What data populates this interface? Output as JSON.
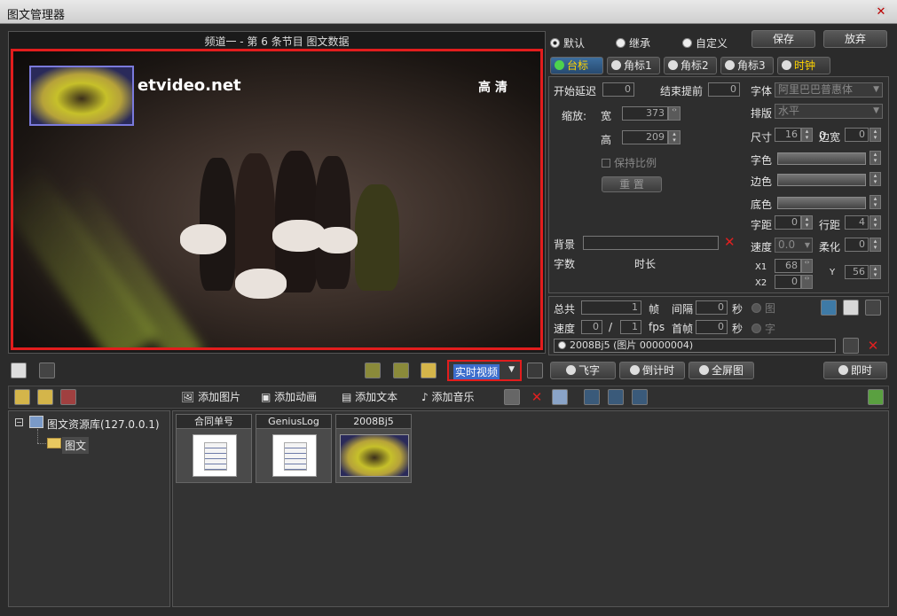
{
  "window": {
    "title": "图文管理器"
  },
  "preview": {
    "caption": "频道一 - 第 6 条节目 图文数据",
    "watermark": "etvideo.net",
    "quality_label": "高 清"
  },
  "mode_radios": [
    {
      "label": "默认",
      "selected": true
    },
    {
      "label": "继承",
      "selected": false
    },
    {
      "label": "自定义",
      "selected": false
    }
  ],
  "actions": {
    "save": "保存",
    "discard": "放弃"
  },
  "tabs": [
    {
      "label": "台标",
      "active": true,
      "color": "#ffd400"
    },
    {
      "label": "角标1",
      "active": false,
      "color": "#e6e6e6"
    },
    {
      "label": "角标2",
      "active": false,
      "color": "#e6e6e6"
    },
    {
      "label": "角标3",
      "active": false,
      "color": "#e6e6e6"
    },
    {
      "label": "时钟",
      "active": false,
      "color": "#ffd400"
    }
  ],
  "props": {
    "start_delay": {
      "label": "开始延迟",
      "value": "0"
    },
    "end_ahead": {
      "label": "结束提前",
      "value": "0"
    },
    "scale_label": "缩放:",
    "width": {
      "label": "宽",
      "value": "373"
    },
    "height": {
      "label": "高",
      "value": "209"
    },
    "keep_ratio": "保持比例",
    "reset": "重 置",
    "background_label": "背景",
    "frames_label": "字数",
    "duration_label": "时长"
  },
  "font": {
    "font_label": "字体",
    "font_value": "阿里巴巴普惠体",
    "layout_label": "排版",
    "layout_value": "水平",
    "size_label": "尺寸",
    "size_value": "16",
    "border_label": "边宽",
    "border_value": "0",
    "fontcolor_label": "字色",
    "edgecolor_label": "边色",
    "bgcolor_label": "底色",
    "spacing_label": "字距",
    "spacing_value": "0",
    "linespacing_label": "行距",
    "linespacing_value": "4",
    "speed_label": "速度",
    "speed_value": "0.0",
    "soft_label": "柔化",
    "soft_value": "0",
    "x1_label": "X1",
    "x1_value": "68",
    "x2_label": "X2",
    "x2_value": "0",
    "y_label": "Y",
    "y_value": "56"
  },
  "timing": {
    "total_label": "总共",
    "total_value": "1",
    "frames_unit": "帧",
    "interval_label": "间隔",
    "interval_value": "0",
    "seconds_unit": "秒",
    "pic_label": "图",
    "speed_label": "速度",
    "speed_a": "0",
    "slash": "/",
    "speed_b": "1",
    "fps_unit": "fps",
    "first_label": "首帧",
    "first_value": "0",
    "seconds_unit2": "秒",
    "text_label": "字",
    "item_text": "2008Bj5 (图片 00000004)"
  },
  "video_source": {
    "value": "实时视频"
  },
  "mode_buttons": [
    {
      "label": "飞字"
    },
    {
      "label": "倒计时"
    },
    {
      "label": "全屏图"
    },
    {
      "label": "即时"
    }
  ],
  "toolbar2": {
    "add_image": "添加图片",
    "add_anim": "添加动画",
    "add_text": "添加文本",
    "add_music": "添加音乐"
  },
  "tree": {
    "root": "图文资源库(127.0.0.1)",
    "child": "图文"
  },
  "library": [
    {
      "name": "合同单号",
      "type": "text"
    },
    {
      "name": "GeniusLog",
      "type": "text"
    },
    {
      "name": "2008Bj5",
      "type": "image"
    }
  ]
}
